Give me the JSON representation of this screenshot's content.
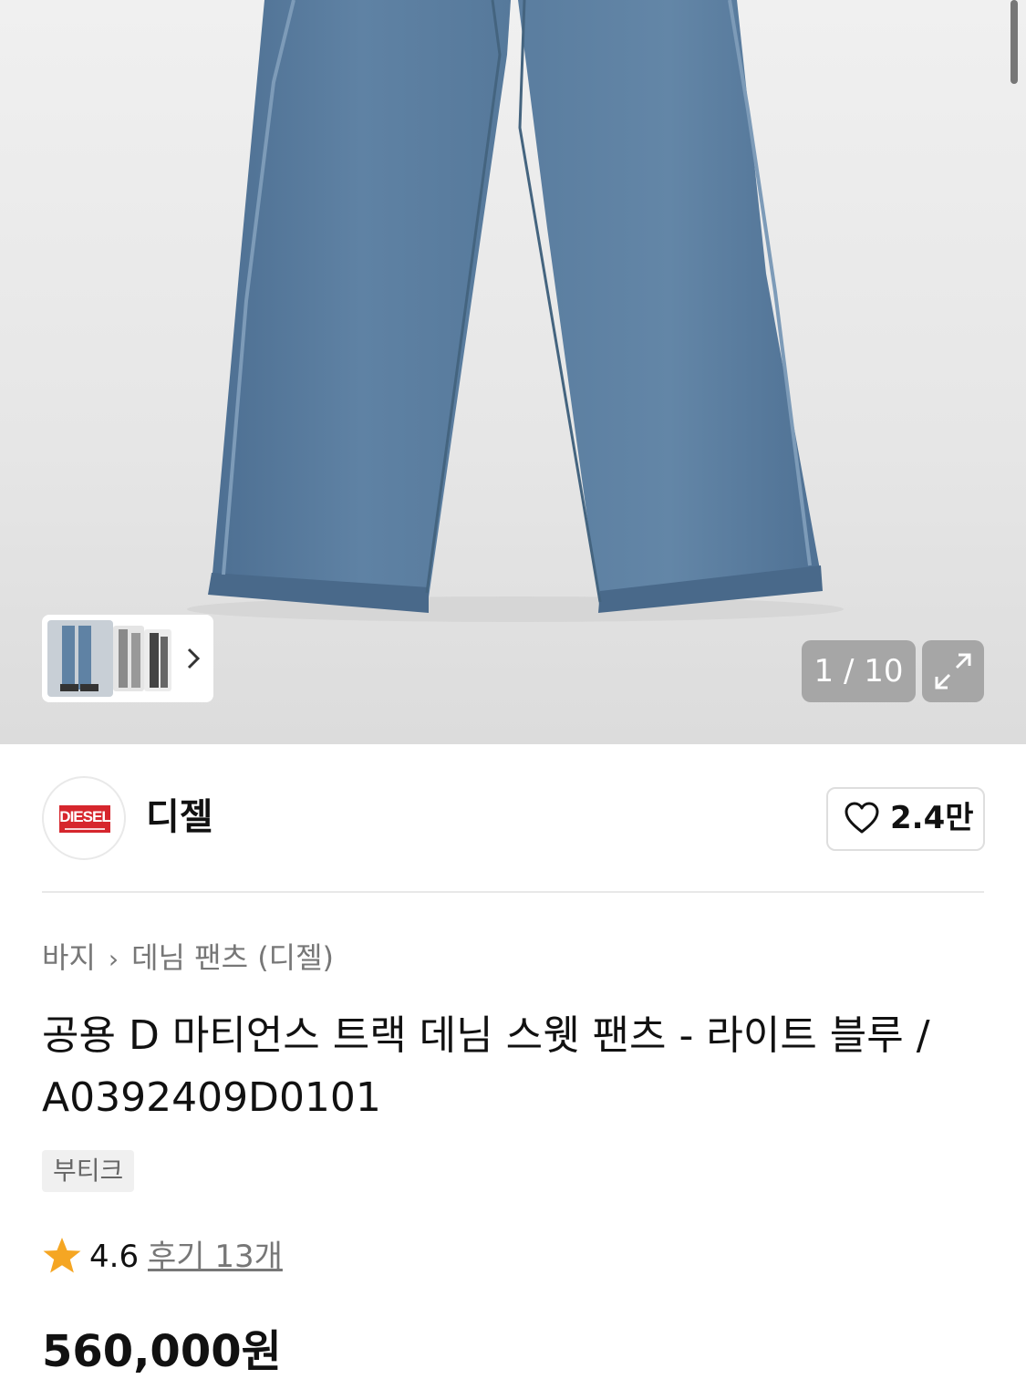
{
  "gallery": {
    "counter_current": "1",
    "counter_total": "10",
    "counter_text": "1 / 10",
    "expand_icon": "expand-icon",
    "next_icon": "chevron-right-icon",
    "thumbnail_count_visible": 3
  },
  "brand": {
    "logo_text": "DIESEL",
    "name": "디젤",
    "like_icon": "heart-icon",
    "like_count": "2.4만"
  },
  "breadcrumb": {
    "category": "바지",
    "subcategory": "데님 팬츠 (디젤)"
  },
  "product": {
    "title": "공용 D 마티언스 트랙 데님 스웻 팬츠 - 라이트 블루 / A0392409D0101",
    "badge": "부티크",
    "rating": "4.6",
    "review_link": "후기 13개",
    "price": "560,000원"
  },
  "colors": {
    "accent_star": "#f5a623",
    "denim": "#5b7ea0",
    "overlay_button": "#a6a6a6"
  }
}
